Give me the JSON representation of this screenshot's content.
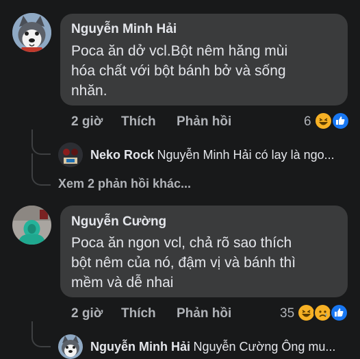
{
  "comments": [
    {
      "author": "Nguyễn Minh Hải",
      "text_lines": [
        "Poca ăn dở vcl.Bột nêm hăng mùi",
        "hóa chất với bột bánh bở và sống",
        "nhăn."
      ],
      "time": "2 giờ",
      "like_label": "Thích",
      "reply_label": "Phản hồi",
      "reaction_count": "6",
      "reply": {
        "author": "Neko Rock",
        "text": "Nguyễn Minh Hải có lay là ngo..."
      },
      "more_replies": "Xem 2 phản hồi khác..."
    },
    {
      "author": "Nguyễn Cường",
      "text_lines": [
        "Poca ăn ngon vcl, chả rõ sao thích",
        "bột nêm của nó, đậm vị và bánh thì",
        "mềm và dễ nhai"
      ],
      "time": "2 giờ",
      "like_label": "Thích",
      "reply_label": "Phản hồi",
      "reaction_count": "35",
      "reply": {
        "author": "Nguyễn Minh Hải",
        "text": "Nguyễn Cường Ông mu..."
      }
    }
  ],
  "colors": {
    "background": "#18191a",
    "bubble": "#3a3b3c",
    "text": "#e4e6eb",
    "secondary": "#b0b3b8",
    "like_blue": "#1877f2",
    "haha_yellow": "#f7b125"
  },
  "icons": [
    "husky-avatar",
    "neko-avatar",
    "green-hoodie-avatar",
    "haha-reaction-icon",
    "like-reaction-icon",
    "sad-reaction-icon"
  ]
}
